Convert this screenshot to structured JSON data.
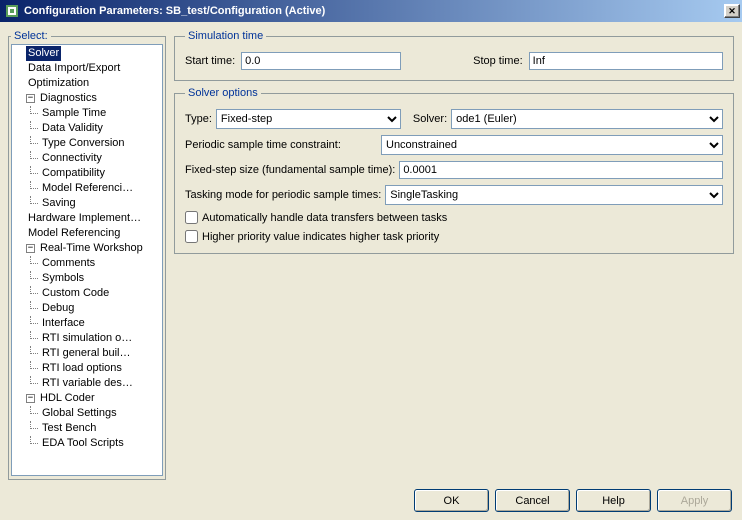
{
  "window": {
    "title": "Configuration Parameters: SB_test/Configuration (Active)"
  },
  "select_legend": "Select:",
  "tree": {
    "solver": "Solver",
    "data_io": "Data Import/Export",
    "optimization": "Optimization",
    "diagnostics": "Diagnostics",
    "diag": {
      "sample_time": "Sample Time",
      "data_validity": "Data Validity",
      "type_conversion": "Type Conversion",
      "connectivity": "Connectivity",
      "compatibility": "Compatibility",
      "model_ref": "Model Referenci…",
      "saving": "Saving"
    },
    "hw": "Hardware Implement…",
    "model_ref": "Model Referencing",
    "rtw": "Real-Time Workshop",
    "rtw_c": {
      "comments": "Comments",
      "symbols": "Symbols",
      "custom_code": "Custom Code",
      "debug": "Debug",
      "interface": "Interface",
      "rti_sim": "RTI simulation o…",
      "rti_gen": "RTI general buil…",
      "rti_load": "RTI load options",
      "rti_var": "RTI variable des…"
    },
    "hdl": "HDL Coder",
    "hdl_c": {
      "global": "Global Settings",
      "tb": "Test Bench",
      "eda": "EDA Tool Scripts"
    }
  },
  "sim": {
    "legend": "Simulation time",
    "start_label": "Start time:",
    "start_value": "0.0",
    "stop_label": "Stop time:",
    "stop_value": "Inf"
  },
  "solver": {
    "legend": "Solver options",
    "type_label": "Type:",
    "type_value": "Fixed-step",
    "solver_label": "Solver:",
    "solver_value": "ode1 (Euler)",
    "periodic_label": "Periodic sample time constraint:",
    "periodic_value": "Unconstrained",
    "fixedstep_label": "Fixed-step size (fundamental sample time):",
    "fixedstep_value": "0.0001",
    "tasking_label": "Tasking mode for periodic sample times:",
    "tasking_value": "SingleTasking",
    "auto_transfer": "Automatically handle data transfers between tasks",
    "higher_priority": "Higher priority value indicates higher task priority"
  },
  "buttons": {
    "ok": "OK",
    "cancel": "Cancel",
    "help": "Help",
    "apply": "Apply"
  }
}
